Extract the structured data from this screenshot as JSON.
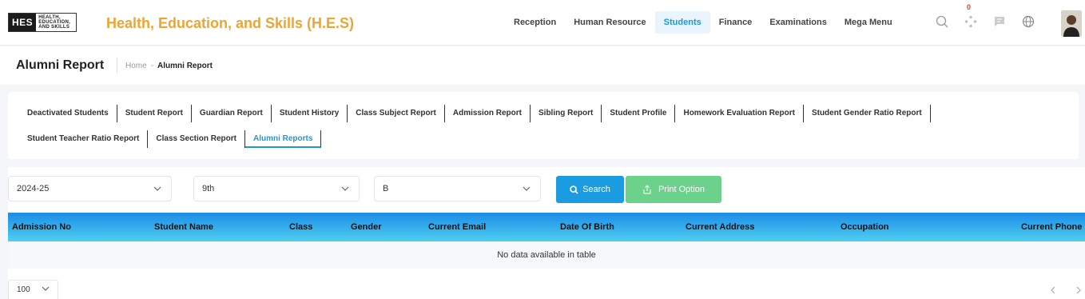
{
  "header": {
    "logo_short": "HES",
    "logo_words": [
      "HEALTH,",
      "EDUCATION,",
      "AND SKILLS"
    ],
    "app_title": "Health, Education, and Skills (H.E.S)",
    "nav": [
      {
        "label": "Reception"
      },
      {
        "label": "Human Resource"
      },
      {
        "label": "Students",
        "active": true
      },
      {
        "label": "Finance"
      },
      {
        "label": "Examinations"
      },
      {
        "label": "Mega Menu"
      }
    ],
    "notification_count": "0",
    "icons": [
      "search-icon",
      "diamond-dots-icon",
      "chat-icon",
      "globe-icon"
    ]
  },
  "page": {
    "title": "Alumni Report",
    "breadcrumb": {
      "home": "Home",
      "sep": "-",
      "current": "Alumni Report"
    }
  },
  "tabs": {
    "row1": [
      "Deactivated Students",
      "Student Report",
      "Guardian Report",
      "Student History",
      "Class Subject Report",
      "Admission Report",
      "Sibling Report",
      "Student Profile",
      "Homework Evaluation Report",
      "Student Gender Ratio Report"
    ],
    "row2": [
      "Student Teacher Ratio Report",
      "Class Section Report",
      "Alumni Reports"
    ],
    "active": "Alumni Reports"
  },
  "filters": {
    "session": "2024-25",
    "class": "9th",
    "section": "B",
    "search_label": "Search",
    "print_label": "Print Option"
  },
  "table": {
    "columns": [
      "Admission No",
      "Student Name",
      "Class",
      "Gender",
      "Current Email",
      "Date Of Birth",
      "Current Address",
      "Occupation",
      "Current Phone"
    ],
    "empty_message": "No data available in table",
    "page_size": "100"
  },
  "colors": {
    "brand_orange": "#f0a430",
    "accent_blue": "#1a9ad9",
    "search_btn": "#1b9be0",
    "print_btn": "#6bd18b"
  }
}
